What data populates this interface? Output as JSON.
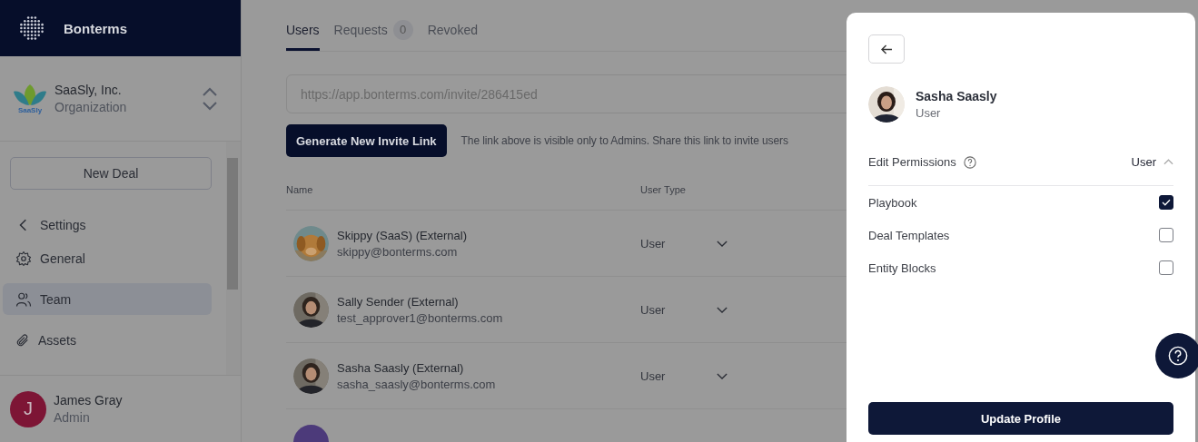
{
  "app": {
    "name": "Bonterms"
  },
  "org": {
    "logo_text": "SaaSly",
    "name": "SaaSly, Inc.",
    "type": "Organization"
  },
  "new_deal": "New Deal",
  "nav": {
    "back": "Settings",
    "items": [
      {
        "label": "General",
        "kind": "gear",
        "selected": false
      },
      {
        "label": "Team",
        "kind": "people",
        "selected": true
      },
      {
        "label": "Assets",
        "kind": "clip",
        "selected": false
      }
    ]
  },
  "current_user": {
    "initial": "J",
    "name": "James Gray",
    "role": "Admin"
  },
  "tabs": [
    {
      "label": "Users",
      "selected": true
    },
    {
      "label": "Requests",
      "count": "0",
      "selected": false
    },
    {
      "label": "Revoked",
      "selected": false
    }
  ],
  "invite": {
    "url": "https://app.bonterms.com/invite/286415ed",
    "button": "Generate New Invite Link",
    "note": "The link above is visible only to Admins. Share this link to invite users"
  },
  "table": {
    "columns": [
      "Name",
      "User Type"
    ],
    "rows": [
      {
        "kind": "pet",
        "name": "Skippy (SaaS) (External)",
        "email": "skippy@bonterms.com",
        "user_type": "User"
      },
      {
        "kind": "person",
        "name": "Sally Sender (External)",
        "email": "test_approver1@bonterms.com",
        "user_type": "User"
      },
      {
        "kind": "person",
        "name": "Sasha Saasly (External)",
        "email": "sasha_saasly@bonterms.com",
        "user_type": "User"
      },
      {
        "kind": "letter"
      }
    ]
  },
  "panel": {
    "profile": {
      "name": "Sasha Saasly",
      "role": "User"
    },
    "permissions": {
      "label": "Edit Permissions",
      "value": "User",
      "expanded": true,
      "items": [
        {
          "label": "Playbook",
          "checked": true
        },
        {
          "label": "Deal Templates",
          "checked": false
        },
        {
          "label": "Entity Blocks",
          "checked": false
        }
      ]
    },
    "submit": "Update Profile"
  }
}
